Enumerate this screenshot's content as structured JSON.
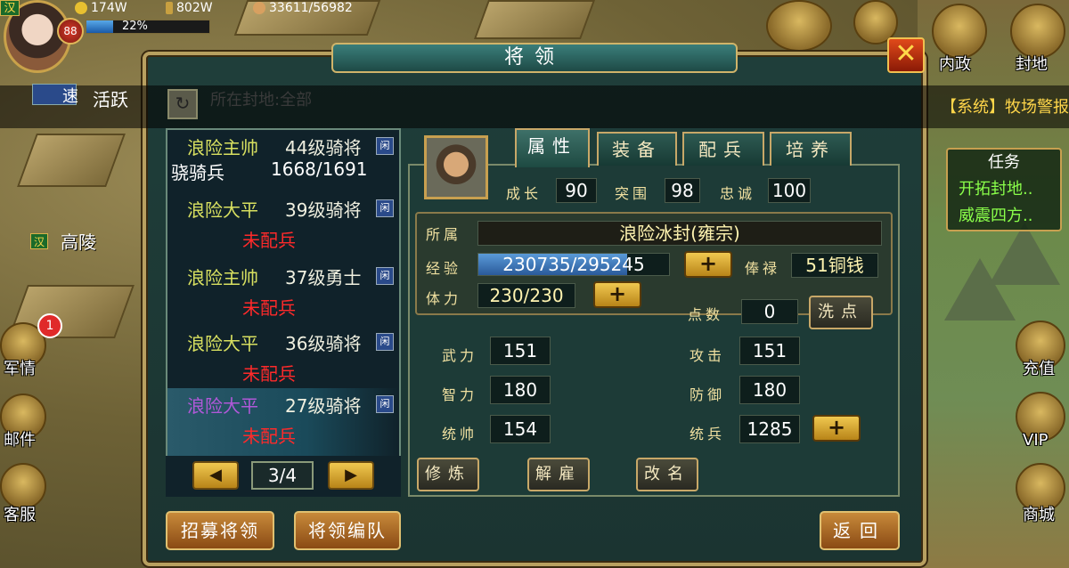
{
  "hud": {
    "nation": "汉",
    "level": "88",
    "gold": "174W",
    "food": "802W",
    "population": "33611/56982",
    "exp_percent": "22%",
    "active_label": "活跃",
    "guild_label": "速"
  },
  "map": {
    "city_label": "高陵",
    "city_flag": "汉"
  },
  "top_buttons": [
    {
      "label": "内政"
    },
    {
      "label": "封地"
    }
  ],
  "left_buttons": [
    {
      "label": "军情",
      "badge": "1"
    },
    {
      "label": "邮件"
    },
    {
      "label": "客服"
    }
  ],
  "right_buttons": [
    {
      "label": "充值"
    },
    {
      "label": "VIP"
    },
    {
      "label": "商城"
    }
  ],
  "system_banner": "【系统】牧场警报",
  "tasks": {
    "title": "任务",
    "items": [
      "开拓封地..",
      "威震四方.."
    ]
  },
  "dialog": {
    "title": "将领",
    "close": "✕",
    "filter_label": "所在封地:全部",
    "generals": [
      {
        "name": "浪险主帅",
        "level": "44级骑将",
        "lock": "闲",
        "troop_type": "骁骑兵",
        "troop_count": "1668/1691"
      },
      {
        "name": "浪险大平",
        "level": "39级骑将",
        "lock": "闲",
        "troop": "未配兵"
      },
      {
        "name": "浪险主帅",
        "level": "37级勇士",
        "lock": "闲",
        "troop": "未配兵"
      },
      {
        "name": "浪险大平",
        "level": "36级骑将",
        "lock": "闲",
        "troop": "未配兵"
      },
      {
        "name": "浪险大平",
        "level": "27级骑将",
        "lock": "闲",
        "troop": "未配兵"
      }
    ],
    "page": "3/4",
    "prev": "◀",
    "next": "▶",
    "tabs": [
      "属性",
      "装备",
      "配兵",
      "培养"
    ],
    "growth_label": "成长",
    "growth": "90",
    "breakout_label": "突围",
    "breakout": "98",
    "loyalty_label": "忠诚",
    "loyalty": "100",
    "affiliation_label": "所属",
    "affiliation": "浪险冰封(雍宗)",
    "exp_label": "经验",
    "exp": "230735/295245",
    "exp_ratio": 0.78,
    "salary_label": "俸禄",
    "salary": "51铜钱",
    "stamina_label": "体力",
    "stamina": "230/230",
    "points_label": "点数",
    "points": "0",
    "reset_label": "洗点",
    "force_label": "武力",
    "force": "151",
    "intellect_label": "智力",
    "intellect": "180",
    "command_label": "统帅",
    "command": "154",
    "attack_label": "攻击",
    "attack": "151",
    "defense_label": "防御",
    "defense": "180",
    "troops_label": "统兵",
    "troops": "1285",
    "plus": "+",
    "train_label": "修炼",
    "dismiss_label": "解雇",
    "rename_label": "改名",
    "recruit_label": "招募将领",
    "formation_label": "将领编队",
    "back_label": "返回"
  }
}
